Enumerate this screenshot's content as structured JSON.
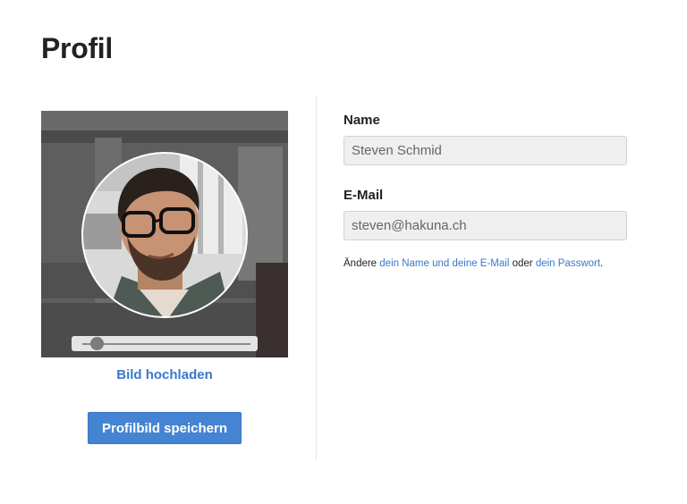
{
  "page": {
    "title": "Profil"
  },
  "photo": {
    "upload_label": "Bild hochladen",
    "save_label": "Profilbild speichern",
    "zoom_level": 0.05
  },
  "form": {
    "name_label": "Name",
    "name_value": "Steven Schmid",
    "email_label": "E-Mail",
    "email_value": "steven@hakuna.ch"
  },
  "hint": {
    "prefix": "Ändere ",
    "link_name_email": "dein Name und deine E-Mail",
    "middle": " oder ",
    "link_password": "dein Passwort",
    "suffix": "."
  },
  "colors": {
    "accent": "#4584d3",
    "link": "#3a78c9"
  }
}
